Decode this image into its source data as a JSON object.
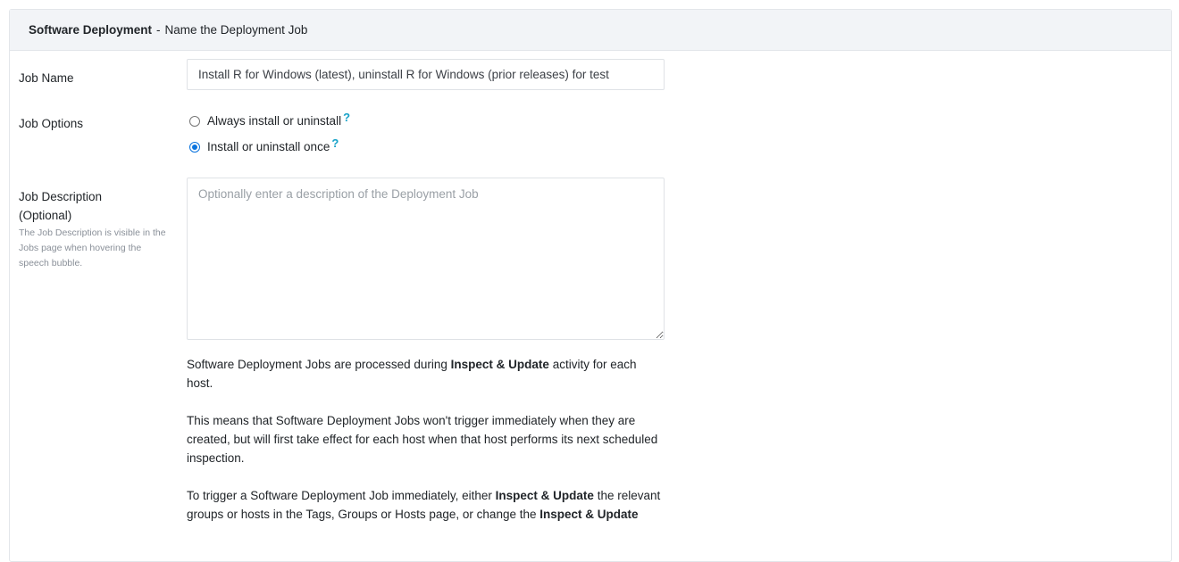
{
  "header": {
    "title_strong": "Software Deployment",
    "separator": "-",
    "title_rest": "Name the Deployment Job"
  },
  "form": {
    "job_name": {
      "label": "Job Name",
      "value": "Install R for Windows (latest), uninstall R for Windows (prior releases) for test"
    },
    "job_options": {
      "label": "Job Options",
      "options": [
        {
          "label": "Always install or uninstall",
          "checked": false,
          "help": "?"
        },
        {
          "label": "Install or uninstall once",
          "checked": true,
          "help": "?"
        }
      ]
    },
    "job_description": {
      "label_line1": "Job Description",
      "label_line2": "(Optional)",
      "help_text": "The Job Description is visible in the Jobs page when hovering the speech bubble.",
      "placeholder": "Optionally enter a description of the Deployment Job"
    }
  },
  "info": {
    "p1_a": "Software Deployment Jobs are processed during ",
    "p1_b": "Inspect & Update",
    "p1_c": " activity for each host.",
    "p2": "This means that Software Deployment Jobs won't trigger immediately when they are created, but will first take effect for each host when that host performs its next scheduled inspection.",
    "p3_a": "To trigger a Software Deployment Job immediately, either ",
    "p3_b": "Inspect & Update",
    "p3_c": " the relevant groups or hosts in the Tags, Groups or Hosts page, or change the ",
    "p3_d": "Inspect & Update"
  }
}
